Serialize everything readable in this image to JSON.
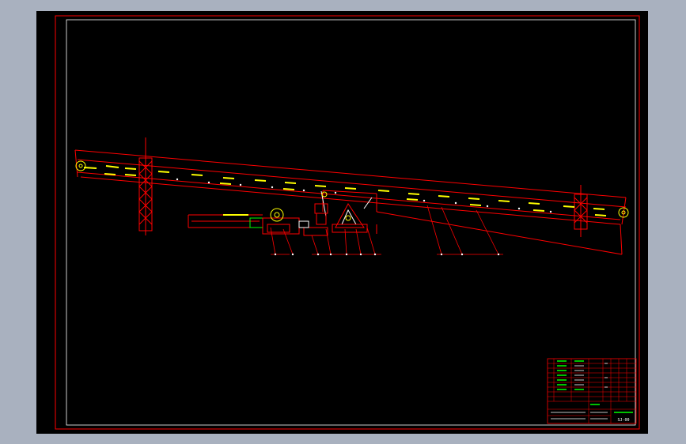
{
  "colors": {
    "background": "#a9b1bf",
    "canvas": "#000000",
    "frame": "#ff0000",
    "text": "#ffff00",
    "green": "#00ff00",
    "white": "#ffffff"
  },
  "title_block": {
    "drawing_number": "SJ-00"
  }
}
